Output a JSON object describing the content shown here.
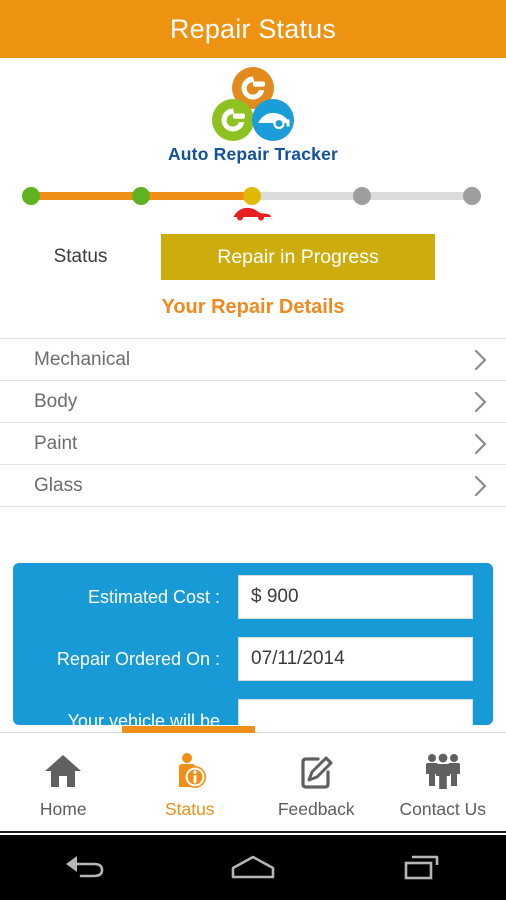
{
  "header": {
    "title": "Repair Status",
    "bg_color": "#ee9211",
    "text_color": "#ffffff"
  },
  "logo": {
    "brand_text": "Auto Repair Tracker",
    "brand_color": "#12519e",
    "circle_top_color": "#e28b1c",
    "circle_left_color": "#8dc220",
    "circle_right_color": "#1b9dd9"
  },
  "stepper": {
    "total_steps": 5,
    "current_step": 3,
    "done_color": "#5fb321",
    "current_color": "#e0b904",
    "pending_color": "#9e9e9e",
    "track_done_color": "#ef8f17",
    "track_pending_color": "#dcdcdc",
    "vehicle_marker_color": "#e81f1f",
    "steps": [
      {
        "state": "done"
      },
      {
        "state": "done"
      },
      {
        "state": "current"
      },
      {
        "state": "pending"
      },
      {
        "state": "pending"
      }
    ]
  },
  "status": {
    "label": "Status",
    "value": "Repair in Progress",
    "button_color": "#ccad0d",
    "button_text_color": "#ffffff"
  },
  "details_heading": {
    "text": "Your Repair Details",
    "color": "#ef8a21"
  },
  "repair_list": {
    "items": [
      {
        "label": "Mechanical"
      },
      {
        "label": "Body"
      },
      {
        "label": "Paint"
      },
      {
        "label": "Glass"
      }
    ]
  },
  "details_card": {
    "bg_color": "#189ad6",
    "rows": [
      {
        "label": "Estimated Cost :",
        "value": "$ 900",
        "placeholder": ""
      },
      {
        "label": "Repair Ordered On :",
        "value": "07/11/2014",
        "placeholder": ""
      },
      {
        "label": "Your vehicle will be",
        "value": "",
        "placeholder": ""
      }
    ]
  },
  "tabbar": {
    "active_color": "#ef8f17",
    "inactive_color": "#5d5d5d",
    "tabs": [
      {
        "label": "Home",
        "icon": "home-icon",
        "active": false
      },
      {
        "label": "Status",
        "icon": "status-person-info-icon",
        "active": true
      },
      {
        "label": "Feedback",
        "icon": "edit-pencil-icon",
        "active": false
      },
      {
        "label": "Contact Us",
        "icon": "people-group-icon",
        "active": false
      }
    ]
  },
  "system_nav": {
    "buttons": [
      {
        "name": "back-icon"
      },
      {
        "name": "home-icon"
      },
      {
        "name": "recent-apps-icon"
      }
    ]
  }
}
